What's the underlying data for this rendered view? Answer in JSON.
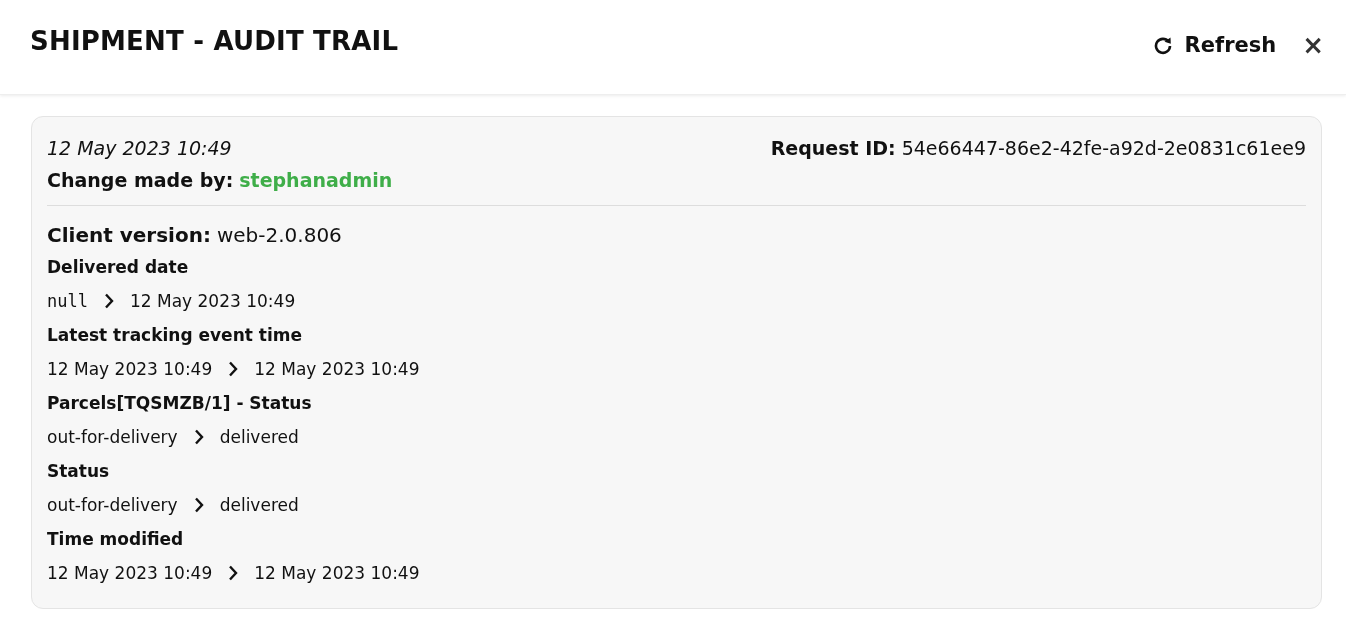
{
  "window": {
    "title": "SHIPMENT - AUDIT TRAIL"
  },
  "toolbar": {
    "refresh": "Refresh",
    "close": "×"
  },
  "entries": [
    {
      "timestamp": "12 May 2023 10:49",
      "request_id_label": "Request ID:",
      "request_id": "54e66447-86e2-42fe-a92d-2e0831c61ee9",
      "changed_by_label": "Change made by:",
      "changed_by": "stephanadmin",
      "client_version_label": "Client version:",
      "client_version": "web-2.0.806",
      "changes": [
        {
          "kind": "code",
          "field": "Delivered date",
          "old": "null",
          "new": "12 May 2023 10:49"
        },
        {
          "kind": "text",
          "field": "Latest tracking event time",
          "old": "12 May 2023 10:49",
          "new": "12 May 2023 10:49"
        },
        {
          "kind": "text",
          "field": "Parcels[TQSMZB/1] - Status",
          "old": "out-for-delivery",
          "new": "delivered"
        },
        {
          "kind": "text",
          "field": "Status",
          "old": "out-for-delivery",
          "new": "delivered"
        },
        {
          "kind": "text",
          "field": "Time modified",
          "old": "12 May 2023 10:49",
          "new": "12 May 2023 10:49"
        }
      ]
    }
  ]
}
